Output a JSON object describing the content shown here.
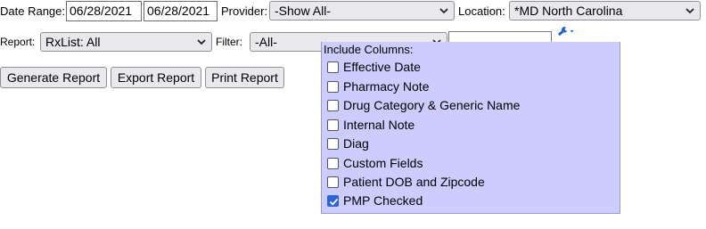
{
  "filters": {
    "date_range_label": "Date Range:",
    "date_from": "06/28/2021",
    "date_to": "06/28/2021",
    "provider_label": "Provider:",
    "provider_value": "-Show All-",
    "location_label": "Location:",
    "location_value": "*MD North Carolina",
    "report_label": "Report:",
    "report_value": "RxList: All",
    "filter_label": "Filter:",
    "filter_value": "-All-",
    "search_value": ""
  },
  "buttons": {
    "generate": "Generate Report",
    "export": "Export Report",
    "print": "Print Report"
  },
  "columns_panel": {
    "title": "Include Columns:",
    "options": [
      {
        "label": "Effective Date",
        "checked": false
      },
      {
        "label": "Pharmacy Note",
        "checked": false
      },
      {
        "label": "Drug Category & Generic Name",
        "checked": false
      },
      {
        "label": "Internal Note",
        "checked": false
      },
      {
        "label": "Diag",
        "checked": false
      },
      {
        "label": "Custom Fields",
        "checked": false
      },
      {
        "label": "Patient DOB and Zipcode",
        "checked": false
      },
      {
        "label": "PMP Checked",
        "checked": true
      }
    ]
  },
  "icons": {
    "settings_dropdown": "wrench-icon",
    "select_arrow": "chevron-down-icon"
  },
  "colors": {
    "panel_bg": "#ccccff",
    "checkbox_checked": "#2b64d8",
    "wrench": "#2a62c9"
  }
}
